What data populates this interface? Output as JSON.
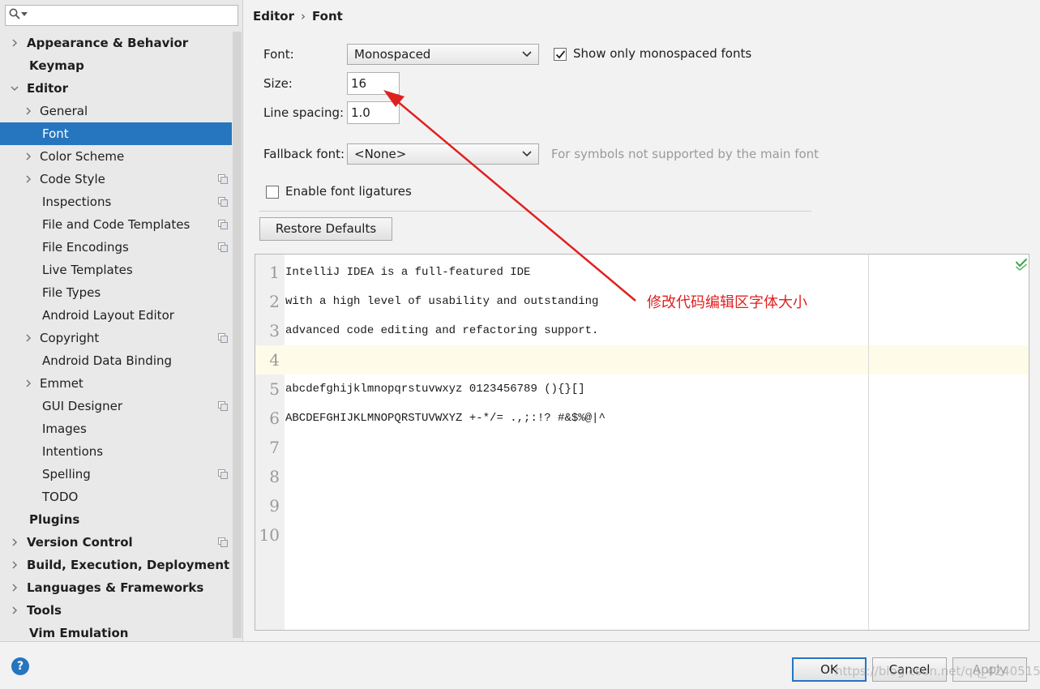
{
  "search": {
    "placeholder": "",
    "icon": "search-icon"
  },
  "sidebar": {
    "items": [
      {
        "label": "Appearance & Behavior",
        "bold": true,
        "chevron": "right",
        "indent": 0
      },
      {
        "label": "Keymap",
        "bold": true,
        "chevron": "",
        "indent": 0
      },
      {
        "label": "Editor",
        "bold": true,
        "chevron": "down",
        "indent": 0
      },
      {
        "label": "General",
        "chevron": "right",
        "indent": 1
      },
      {
        "label": "Font",
        "selected": true,
        "indent": 2
      },
      {
        "label": "Color Scheme",
        "chevron": "right",
        "indent": 1
      },
      {
        "label": "Code Style",
        "chevron": "right",
        "indent": 1,
        "project": true
      },
      {
        "label": "Inspections",
        "indent": 2,
        "project": true
      },
      {
        "label": "File and Code Templates",
        "indent": 2,
        "project": true
      },
      {
        "label": "File Encodings",
        "indent": 2,
        "project": true
      },
      {
        "label": "Live Templates",
        "indent": 2
      },
      {
        "label": "File Types",
        "indent": 2
      },
      {
        "label": "Android Layout Editor",
        "indent": 2
      },
      {
        "label": "Copyright",
        "chevron": "right",
        "indent": 1,
        "project": true
      },
      {
        "label": "Android Data Binding",
        "indent": 2
      },
      {
        "label": "Emmet",
        "chevron": "right",
        "indent": 1
      },
      {
        "label": "GUI Designer",
        "indent": 2,
        "project": true
      },
      {
        "label": "Images",
        "indent": 2
      },
      {
        "label": "Intentions",
        "indent": 2
      },
      {
        "label": "Spelling",
        "indent": 2,
        "project": true
      },
      {
        "label": "TODO",
        "indent": 2
      },
      {
        "label": "Plugins",
        "bold": true,
        "indent": 0
      },
      {
        "label": "Version Control",
        "bold": true,
        "chevron": "right",
        "indent": 0,
        "project": true
      },
      {
        "label": "Build, Execution, Deployment",
        "bold": true,
        "chevron": "right",
        "indent": 0
      },
      {
        "label": "Languages & Frameworks",
        "bold": true,
        "chevron": "right",
        "indent": 0
      },
      {
        "label": "Tools",
        "bold": true,
        "chevron": "right",
        "indent": 0
      },
      {
        "label": "Vim Emulation",
        "bold": true,
        "indent": 0
      }
    ]
  },
  "breadcrumb": {
    "parent": "Editor",
    "separator": "›",
    "current": "Font"
  },
  "font": {
    "font_label": "Font:",
    "font_value": "Monospaced",
    "monospaced_only_label": "Show only monospaced fonts",
    "monospaced_only_checked": true,
    "size_label": "Size:",
    "size_value": "16",
    "line_spacing_label": "Line spacing:",
    "line_spacing_value": "1.0",
    "fallback_label": "Fallback font:",
    "fallback_value": "<None>",
    "fallback_hint": "For symbols not supported by the main font",
    "ligatures_label": "Enable font ligatures",
    "ligatures_checked": false,
    "restore_label": "Restore Defaults"
  },
  "preview": {
    "lines": [
      {
        "num": "1",
        "text": "IntelliJ IDEA is a full-featured IDE"
      },
      {
        "num": "2",
        "text": "with a high level of usability and outstanding"
      },
      {
        "num": "3",
        "text": "advanced code editing and refactoring support."
      },
      {
        "num": "4",
        "text": ""
      },
      {
        "num": "5",
        "text": "abcdefghijklmnopqrstuvwxyz 0123456789 (){}[]"
      },
      {
        "num": "6",
        "text": "ABCDEFGHIJKLMNOPQRSTUVWXYZ +-*/= .,;:!? #&$%@|^"
      },
      {
        "num": "7",
        "text": ""
      },
      {
        "num": "8",
        "text": ""
      },
      {
        "num": "9",
        "text": ""
      },
      {
        "num": "10",
        "text": ""
      }
    ],
    "current_line": 4
  },
  "annotation": {
    "text": "修改代码编辑区字体大小",
    "color": "#e02020"
  },
  "buttons": {
    "help": "?",
    "ok": "OK",
    "cancel": "Cancel",
    "apply": "Apply"
  },
  "watermark": "https://blog.csdn.net/qq_42405152",
  "colors": {
    "accent": "#2675bf",
    "current_line_bg": "#fefbe8",
    "sidebar_bg": "#e9e9e9"
  }
}
